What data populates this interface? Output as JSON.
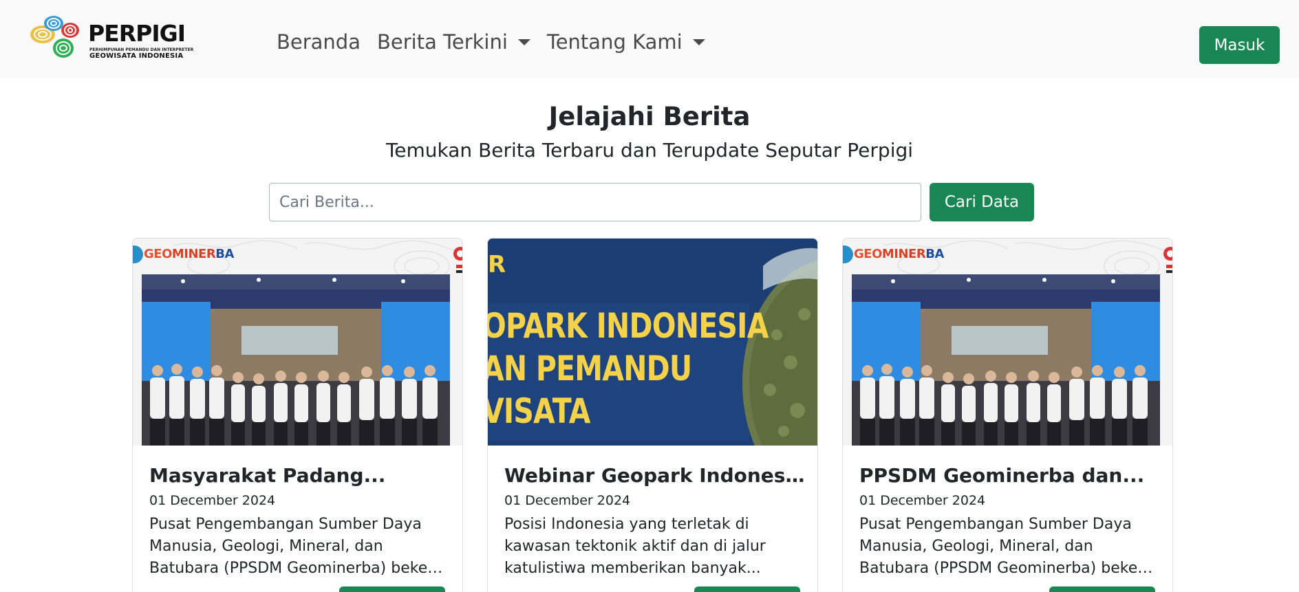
{
  "brand": {
    "name": "PERPIGI",
    "tagline_top": "PERHIMPUNAN PEMANDU DAN INTERPRETER",
    "tagline_bottom": "GEOWISATA INDONESIA"
  },
  "nav": {
    "items": [
      {
        "label": "Beranda",
        "dropdown": false
      },
      {
        "label": "Berita Terkini",
        "dropdown": true
      },
      {
        "label": "Tentang Kami",
        "dropdown": true
      }
    ],
    "login_label": "Masuk"
  },
  "hero": {
    "title": "Jelajahi Berita",
    "subtitle": "Temukan Berita Terbaru dan Terupdate Seputar Perpigi"
  },
  "search": {
    "placeholder": "Cari Berita...",
    "value": "",
    "button_label": "Cari Data"
  },
  "cards": [
    {
      "title": "Masyarakat Padang...",
      "date": "01 December 2024",
      "excerpt_lines": [
        "Pusat Pengembangan Sumber Daya",
        "Manusia, Geologi, Mineral, dan",
        "Batubara (PPSDM Geominerba) bekerj..."
      ],
      "image_brand": {
        "g": "GEO",
        "m": "MINER",
        "b": "BA"
      }
    },
    {
      "title": "Webinar Geopark Indonesi...",
      "date": "01 December 2024",
      "excerpt_lines": [
        "Posisi Indonesia yang terletak di",
        "kawasan tektonik aktif dan di jalur",
        "katulistiwa memberikan banyak..."
      ],
      "banner_lines": [
        "OPARK INDONESIA",
        "AN PEMANDU",
        "VISATA"
      ],
      "banner_fragment": "R"
    },
    {
      "title": "PPSDM Geominerba dan...",
      "date": "01 December 2024",
      "excerpt_lines": [
        "Pusat Pengembangan Sumber Daya",
        "Manusia, Geologi, Mineral, dan",
        "Batubara (PPSDM Geominerba) bekerj..."
      ],
      "image_brand": {
        "g": "GEO",
        "m": "MINER",
        "b": "BA"
      }
    }
  ],
  "colors": {
    "primary": "#198754",
    "navbar_bg": "#f9f9f9",
    "banner_bg": "#1c3e72",
    "banner_text": "#f4d24a"
  }
}
